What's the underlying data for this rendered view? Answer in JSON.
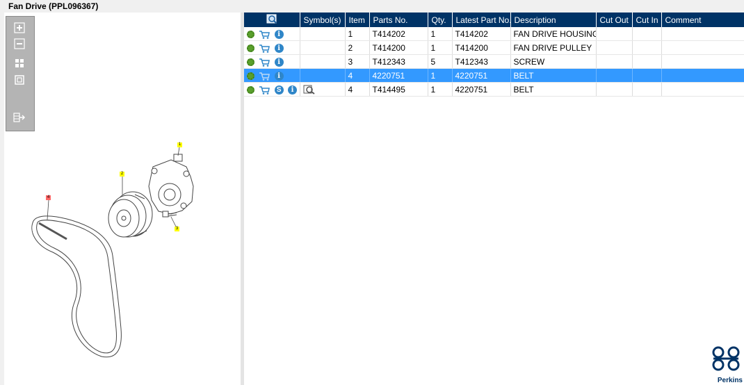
{
  "window": {
    "title": "Fan Drive (PPL096367)"
  },
  "table": {
    "headers": {
      "symbols": "Symbol(s)",
      "item": "Item",
      "parts_no": "Parts No.",
      "qty": "Qty.",
      "latest": "Latest Part No.",
      "description": "Description",
      "cut_out": "Cut Out",
      "cut_in": "Cut In",
      "comment": "Comment"
    },
    "rows": [
      {
        "item": "1",
        "parts_no": "T414202",
        "qty": "1",
        "latest": "T414202",
        "description": "FAN DRIVE HOUSING"
      },
      {
        "item": "2",
        "parts_no": "T414200",
        "qty": "1",
        "latest": "T414200",
        "description": "FAN DRIVE PULLEY"
      },
      {
        "item": "3",
        "parts_no": "T412343",
        "qty": "5",
        "latest": "T412343",
        "description": "SCREW"
      },
      {
        "item": "4",
        "parts_no": "4220751",
        "qty": "1",
        "latest": "4220751",
        "description": "BELT"
      },
      {
        "item": "4",
        "parts_no": "T414495",
        "qty": "1",
        "latest": "4220751",
        "description": "BELT"
      }
    ]
  },
  "diagram": {
    "callouts": [
      "1",
      "2",
      "3",
      "4"
    ]
  },
  "icons": {
    "gear": "gear-icon",
    "cart": "cart-icon",
    "info": "info-icon",
    "s": "s-badge-icon",
    "magnifier": "magnifier-icon"
  },
  "brand": {
    "name": "Perkins",
    "color": "#003366",
    "highlight": "#3399ff"
  }
}
